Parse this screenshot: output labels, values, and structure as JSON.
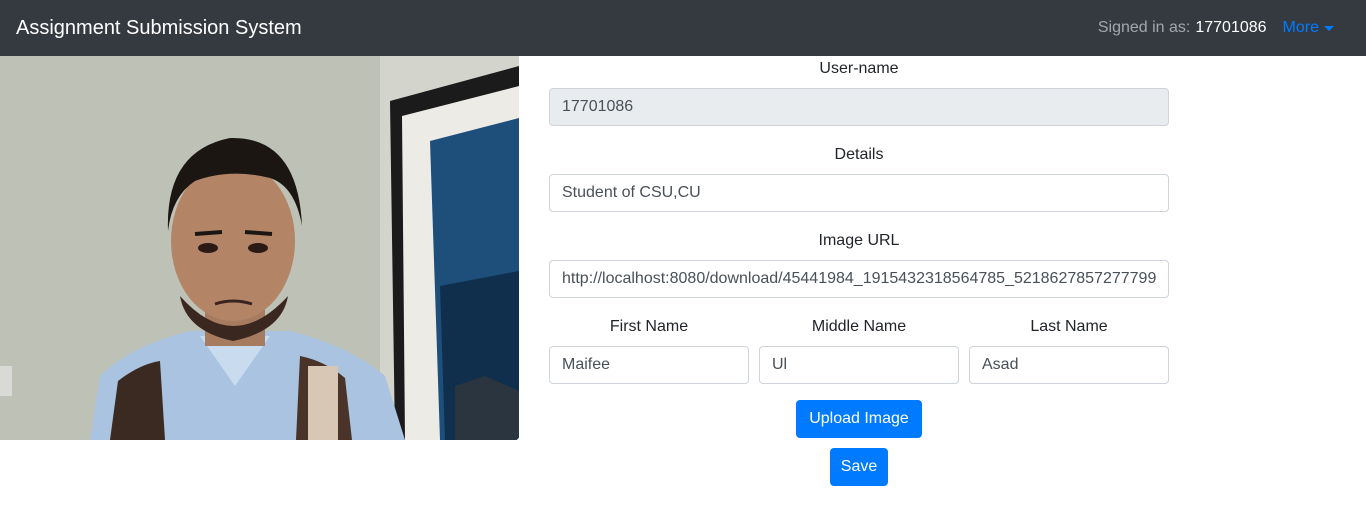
{
  "navbar": {
    "brand": "Assignment Submission System",
    "signed_in_label": "Signed in as:",
    "signed_in_user": "17701086",
    "more_label": "More"
  },
  "form": {
    "username": {
      "label": "User-name",
      "value": "17701086"
    },
    "details": {
      "label": "Details",
      "value": "Student of CSU,CU"
    },
    "image_url": {
      "label": "Image URL",
      "value": "http://localhost:8080/download/45441984_1915432318564785_5218627857277799"
    },
    "first_name": {
      "label": "First Name",
      "value": "Maifee"
    },
    "middle_name": {
      "label": "Middle Name",
      "value": "Ul"
    },
    "last_name": {
      "label": "Last Name",
      "value": "Asad"
    },
    "upload_button": "Upload Image",
    "save_button": "Save"
  },
  "colors": {
    "navbar_bg": "#343a40",
    "primary": "#007bff",
    "readonly_bg": "#e9ecef"
  }
}
